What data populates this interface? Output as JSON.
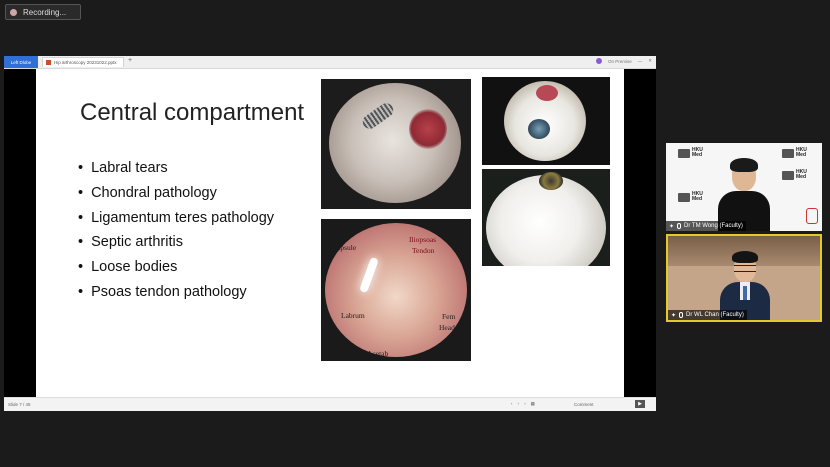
{
  "recording": {
    "label": "Recording..."
  },
  "browser": {
    "left_button": "Left Dlobe",
    "tab_title": "Hip arthroscopy 20231022.pptx",
    "plus": "+",
    "right_text": "On Premise"
  },
  "slide": {
    "title": "Central compartment",
    "bullets": [
      "Labral tears",
      "Chondral pathology",
      "Ligamentum teres pathology",
      "Septic arthritis",
      "Loose bodies",
      "Psoas tendon pathology"
    ],
    "image_labels": {
      "capsule": "Capsule",
      "iliopsoas": "Iliopsoas",
      "tendon": "Tendon",
      "labrum": "Labrum",
      "fem": "Fem",
      "head": "Head",
      "acetab": "Acetab"
    }
  },
  "statusbar": {
    "slide_counter": "Slide 7 / 45",
    "comment": "Comment",
    "play": "▶"
  },
  "participants": [
    {
      "name": "Dr TM Wong (Faculty)"
    },
    {
      "name": "Dr WL Chan (Faculty)"
    }
  ],
  "hku_logo": {
    "line1": "HKU",
    "line2": "Med"
  },
  "colors": {
    "active_speaker_border": "#e3c92a",
    "tab_blue": "#2f6fd6"
  }
}
